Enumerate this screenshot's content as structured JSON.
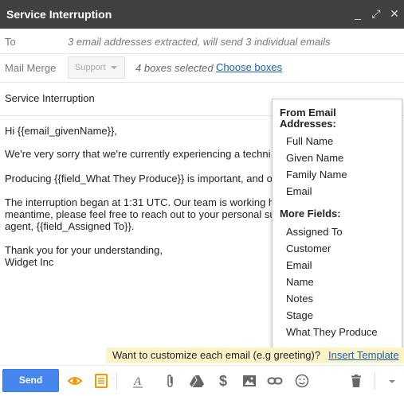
{
  "window": {
    "title": "Service Interruption",
    "controls": {
      "minimize": "_",
      "popout": "⤢",
      "close": "✕"
    }
  },
  "to": {
    "label": "To",
    "info": "3 email addresses extracted, will send 3 individual emails"
  },
  "mail_merge": {
    "label": "Mail Merge",
    "select_value": "Support",
    "boxes_info": "4 boxes selected",
    "choose_link": "Choose boxes"
  },
  "subject": "Service Interruption",
  "body": {
    "greeting": "Hi {{email_givenName}},",
    "line1": "We're very sorry that we're currently experiencing a techni",
    "line2": "Producing {{field_What They Produce}} is important, and o",
    "line3a": "The interruption began at 1:31 UTC. Our team is working h",
    "line3b": "meantime, please feel free to reach out to your personal su",
    "line3c": "agent, {{field_Assigned To}}.",
    "closing1": "Thank you for your understanding,",
    "closing2": "Widget Inc"
  },
  "dropdown": {
    "header1_line1": "From Email",
    "header1_line2": "Addresses:",
    "email_items": [
      "Full Name",
      "Given Name",
      "Family Name",
      "Email"
    ],
    "header2": "More Fields:",
    "field_items": [
      "Assigned To",
      "Customer",
      "Email",
      "Name",
      "Notes",
      "Stage",
      "What They Produce"
    ]
  },
  "tip": {
    "text": "Want to customize each email (e.g greeting)?",
    "link": "Insert Template"
  },
  "toolbar": {
    "send_label": "Send",
    "icons": {
      "track": "eye-icon",
      "template": "template-icon",
      "format": "text-format-icon",
      "attach": "paperclip-icon",
      "drive": "drive-icon",
      "money": "dollar-icon",
      "photo": "image-icon",
      "link": "link-icon",
      "emoji": "smiley-icon",
      "delete": "trash-icon",
      "more": "chevron-down-icon"
    },
    "colors": {
      "send": "#4787ed",
      "track": "#f29900"
    }
  }
}
